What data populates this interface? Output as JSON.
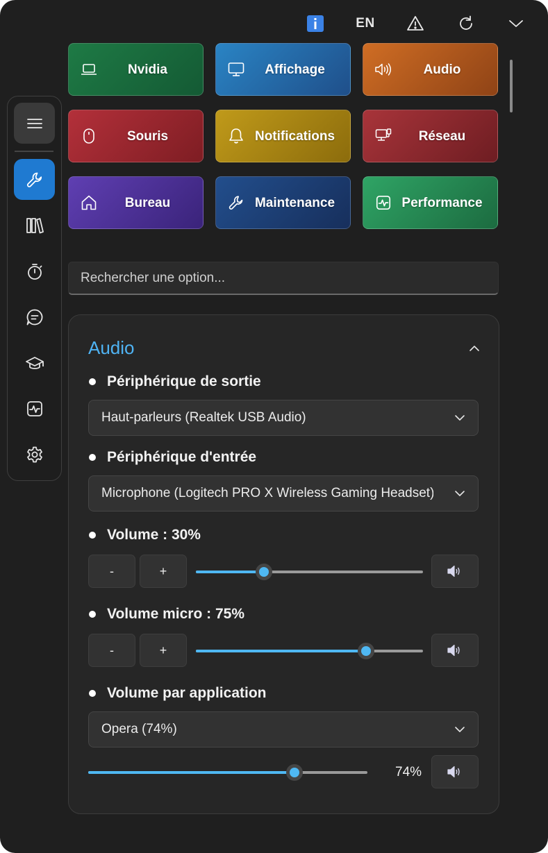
{
  "topbar": {
    "info_icon": "info-icon",
    "language": "EN",
    "warning_icon": "warning-icon",
    "refresh_icon": "refresh-icon",
    "collapse_icon": "chevron-down-icon"
  },
  "sidebar": {
    "items": [
      {
        "name": "menu",
        "icon": "hamburger-icon"
      },
      {
        "name": "tools",
        "icon": "wrench-icon",
        "active": true
      },
      {
        "name": "library",
        "icon": "library-icon"
      },
      {
        "name": "timer",
        "icon": "stopwatch-icon"
      },
      {
        "name": "chat",
        "icon": "chat-icon"
      },
      {
        "name": "learn",
        "icon": "graduation-cap-icon"
      },
      {
        "name": "activity",
        "icon": "activity-icon"
      },
      {
        "name": "settings",
        "icon": "gear-icon"
      }
    ]
  },
  "categories": [
    {
      "label": "Nvidia",
      "icon": "laptop-icon",
      "color": "#1e7a45"
    },
    {
      "label": "Affichage",
      "icon": "monitor-icon",
      "color": "#2a77b5"
    },
    {
      "label": "Audio",
      "icon": "speaker-icon",
      "color": "#c1621f"
    },
    {
      "label": "Souris",
      "icon": "mouse-icon",
      "color": "#b02a2f"
    },
    {
      "label": "Notifications",
      "icon": "bell-icon",
      "color": "#b18a12"
    },
    {
      "label": "Réseau",
      "icon": "network-icon",
      "color": "#a02a30"
    },
    {
      "label": "Bureau",
      "icon": "home-icon",
      "color": "#5a3aa8"
    },
    {
      "label": "Maintenance",
      "icon": "wrench-icon",
      "color": "#1d4a8a"
    },
    {
      "label": "Performance",
      "icon": "activity-icon",
      "color": "#2b9a5c"
    }
  ],
  "search": {
    "placeholder": "Rechercher une option..."
  },
  "audio": {
    "title": "Audio",
    "output_device": {
      "label": "Périphérique de sortie",
      "value": "Haut-parleurs (Realtek USB Audio)"
    },
    "input_device": {
      "label": "Périphérique d'entrée",
      "value": "Microphone (Logitech PRO X Wireless Gaming Headset)"
    },
    "volume": {
      "label": "Volume : 30%",
      "minus": "-",
      "plus": "+",
      "value": 0.3
    },
    "mic_volume": {
      "label": "Volume micro : 75%",
      "minus": "-",
      "plus": "+",
      "value": 0.75
    },
    "app_volume": {
      "label": "Volume par application",
      "selected": "Opera (74%)",
      "value": 0.74,
      "value_text": "74%"
    }
  },
  "colors": {
    "accent": "#4fb8f3",
    "active_nav": "#1f7ad1",
    "background": "#1f1f1f"
  }
}
